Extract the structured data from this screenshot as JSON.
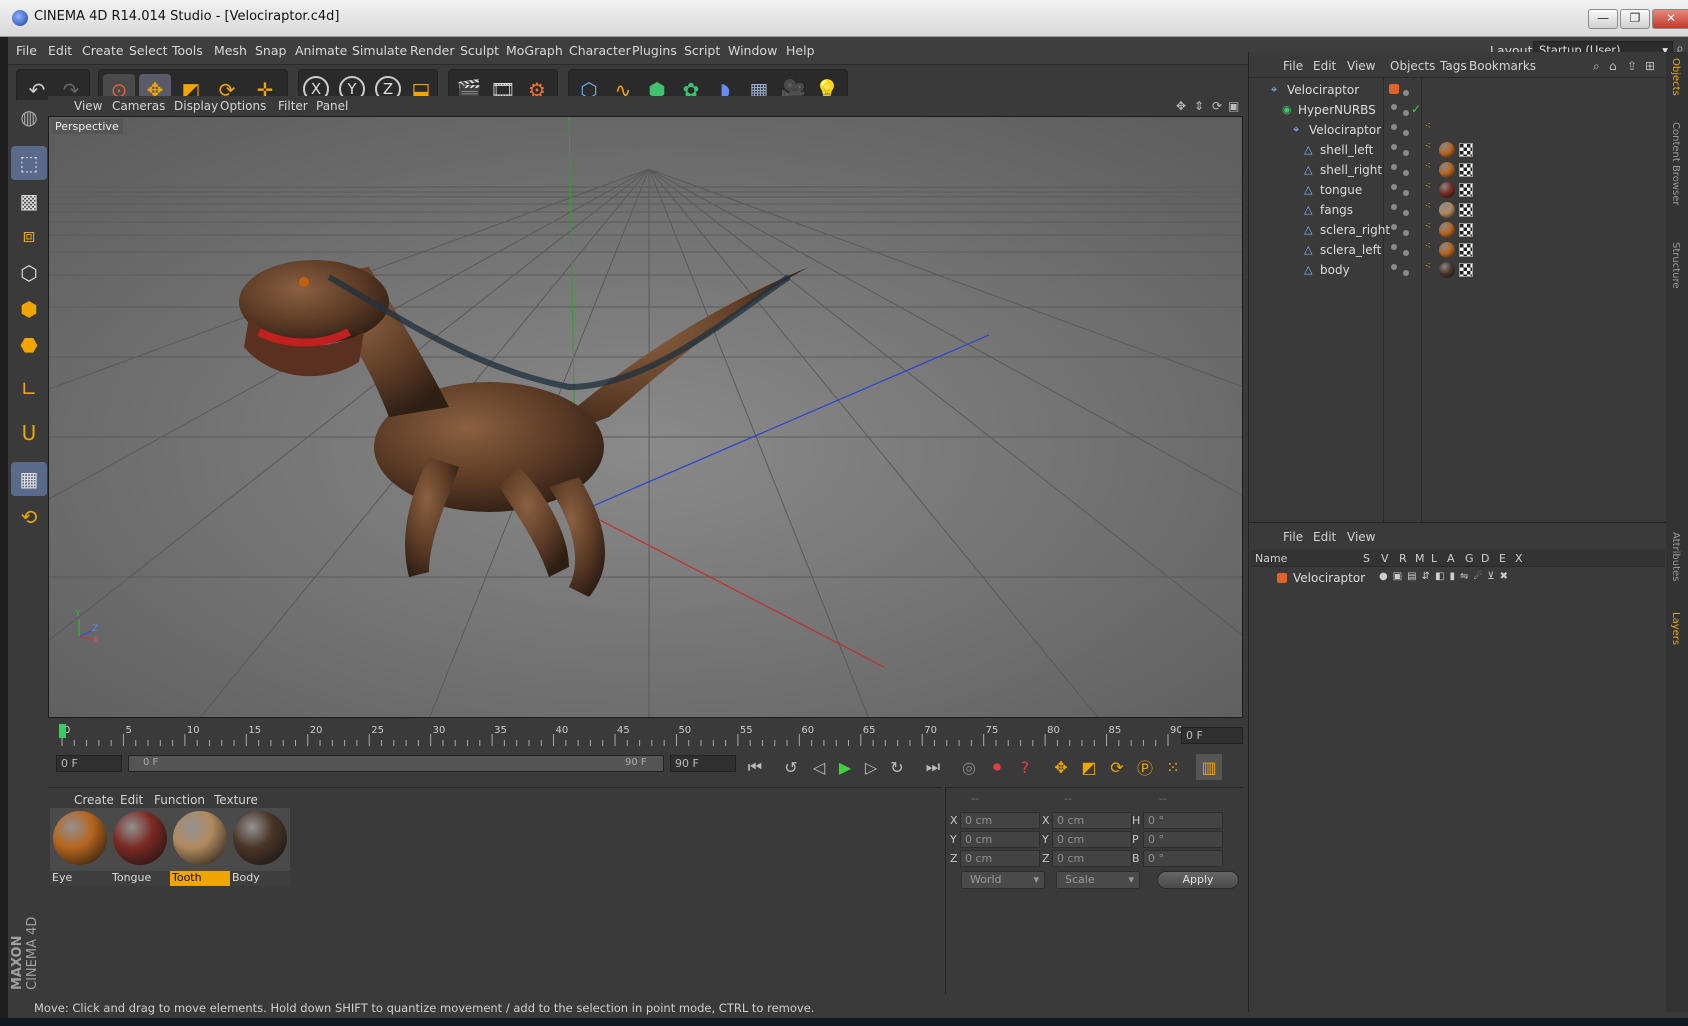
{
  "window": {
    "title": "CINEMA 4D R14.014 Studio - [Velociraptor.c4d]",
    "controls": {
      "minimize": "—",
      "restore": "❐",
      "close": "✕"
    }
  },
  "menubar": {
    "items": [
      "File",
      "Edit",
      "Create",
      "Select",
      "Tools",
      "Mesh",
      "Snap",
      "Animate",
      "Simulate",
      "Render",
      "Sculpt",
      "MoGraph",
      "Character",
      "Plugins",
      "Script",
      "Window",
      "Help"
    ],
    "layout_label": "Layout:",
    "layout_value": "Startup (User)"
  },
  "viewport": {
    "menu": [
      "View",
      "Cameras",
      "Display",
      "Options",
      "Filter",
      "Panel"
    ],
    "camera_label": "Perspective",
    "axis_labels": {
      "y": "Y",
      "z": "Z",
      "x": "X"
    }
  },
  "timeline": {
    "ticks": [
      "0",
      "5",
      "10",
      "15",
      "20",
      "25",
      "30",
      "35",
      "40",
      "45",
      "50",
      "55",
      "60",
      "65",
      "70",
      "75",
      "80",
      "85",
      "90"
    ],
    "current_frame": "0 F",
    "start_field": "0 F",
    "range_start": "0 F",
    "range_end": "90 F",
    "end_field": "90 F"
  },
  "material_manager": {
    "menu": [
      "Create",
      "Edit",
      "Function",
      "Texture"
    ],
    "materials": [
      {
        "name": "Eye",
        "color": "#b5651d",
        "selected": false
      },
      {
        "name": "Tongue",
        "color": "#7a2a22",
        "selected": false
      },
      {
        "name": "Tooth",
        "color": "#b08a5e",
        "selected": true
      },
      {
        "name": "Body",
        "color": "#4a3528",
        "selected": false
      }
    ]
  },
  "coordinates": {
    "headers": [
      "--",
      "--",
      "--"
    ],
    "rows": [
      {
        "pos_label": "X",
        "pos": "0 cm",
        "size_label": "X",
        "size": "0 cm",
        "rot_label": "H",
        "rot": "0 °"
      },
      {
        "pos_label": "Y",
        "pos": "0 cm",
        "size_label": "Y",
        "size": "0 cm",
        "rot_label": "P",
        "rot": "0 °"
      },
      {
        "pos_label": "Z",
        "pos": "0 cm",
        "size_label": "Z",
        "size": "0 cm",
        "rot_label": "B",
        "rot": "0 °"
      }
    ],
    "mode": "World",
    "transform": "Scale",
    "apply": "Apply"
  },
  "status": "Move: Click and drag to move elements. Hold down SHIFT to quantize movement / add to the selection in point mode, CTRL to remove.",
  "object_manager": {
    "menu": [
      "File",
      "Edit",
      "View",
      "Objects",
      "Tags",
      "Bookmarks"
    ],
    "objects": [
      {
        "name": "Velociraptor",
        "type": "null"
      },
      {
        "name": "HyperNURBS",
        "type": "nurbs"
      },
      {
        "name": "Velociraptor",
        "type": "null"
      },
      {
        "name": "shell_left",
        "type": "poly"
      },
      {
        "name": "shell_right",
        "type": "poly"
      },
      {
        "name": "tongue",
        "type": "poly"
      },
      {
        "name": "fangs",
        "type": "poly"
      },
      {
        "name": "sclera_right",
        "type": "poly"
      },
      {
        "name": "sclera_left",
        "type": "poly"
      },
      {
        "name": "body",
        "type": "poly"
      }
    ]
  },
  "layer_manager": {
    "menu": [
      "File",
      "Edit",
      "View"
    ],
    "columns": [
      "Name",
      "S",
      "V",
      "R",
      "M",
      "L",
      "A",
      "G",
      "D",
      "E",
      "X"
    ],
    "layers": [
      {
        "name": "Velociraptor",
        "color": "#e0642a"
      }
    ]
  },
  "side_tabs": [
    "Objects",
    "Content Browser",
    "Structure",
    "Attributes",
    "Layers"
  ],
  "brand": {
    "line1": "MAXON",
    "line2": "CINEMA 4D"
  },
  "colors": {
    "accent": "#f0a500",
    "x_axis": "#d03030",
    "y_axis": "#30c030",
    "z_axis": "#3050e0"
  }
}
